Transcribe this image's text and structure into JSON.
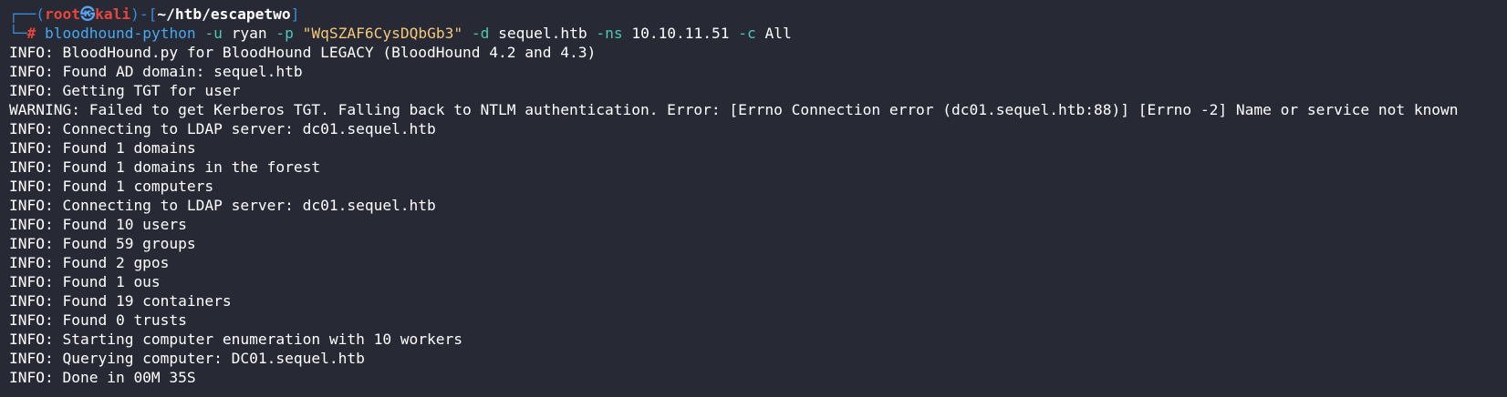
{
  "prompt": {
    "frame_top_left": "┌──(",
    "user": "root",
    "at_symbol": "㉿",
    "host": "kali",
    "close_open": ")-[",
    "cwd": "~/htb/escapetwo",
    "close_bracket": "]",
    "frame_bottom_left": "└─",
    "hash": "#"
  },
  "command": {
    "program": "bloodhound-python",
    "flag_u": "-u",
    "user": "ryan",
    "flag_p": "-p",
    "password": "\"WqSZAF6CysDQbGb3\"",
    "flag_d": "-d",
    "domain": "sequel.htb",
    "flag_ns": "-ns",
    "nameserver": "10.10.11.51",
    "flag_c": "-c",
    "collection": "All"
  },
  "output": [
    "INFO: BloodHound.py for BloodHound LEGACY (BloodHound 4.2 and 4.3)",
    "INFO: Found AD domain: sequel.htb",
    "INFO: Getting TGT for user",
    "WARNING: Failed to get Kerberos TGT. Falling back to NTLM authentication. Error: [Errno Connection error (dc01.sequel.htb:88)] [Errno -2] Name or service not known",
    "INFO: Connecting to LDAP server: dc01.sequel.htb",
    "INFO: Found 1 domains",
    "INFO: Found 1 domains in the forest",
    "INFO: Found 1 computers",
    "INFO: Connecting to LDAP server: dc01.sequel.htb",
    "INFO: Found 10 users",
    "INFO: Found 59 groups",
    "INFO: Found 2 gpos",
    "INFO: Found 1 ous",
    "INFO: Found 19 containers",
    "INFO: Found 0 trusts",
    "INFO: Starting computer enumeration with 10 workers",
    "INFO: Querying computer: DC01.sequel.htb",
    "INFO: Done in 00M 35S"
  ],
  "colors": {
    "background": "#272a35",
    "prompt_frame": "#3d8bd7",
    "prompt_user": "#e8453c",
    "command_name": "#46a9f0",
    "command_flag": "#4fc7b7",
    "string_literal": "#f5c97a",
    "text": "#ffffff"
  }
}
